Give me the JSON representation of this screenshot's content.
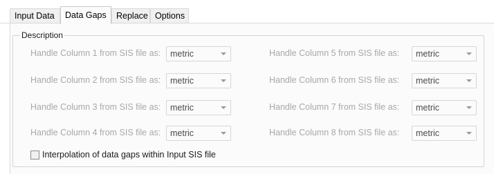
{
  "tabs": [
    {
      "label": "Input Data",
      "active": false
    },
    {
      "label": "Data Gaps",
      "active": true
    },
    {
      "label": "Replace",
      "active": false
    },
    {
      "label": "Options",
      "active": false
    }
  ],
  "group": {
    "title": "Description",
    "rows": [
      {
        "label": "Handle Column 1 from SIS file as:",
        "value": "metric",
        "enabled": false
      },
      {
        "label": "Handle Column 2 from SIS file as:",
        "value": "metric",
        "enabled": false
      },
      {
        "label": "Handle Column 3 from SIS file as:",
        "value": "metric",
        "enabled": false
      },
      {
        "label": "Handle Column 4 from SIS file as:",
        "value": "metric",
        "enabled": false
      },
      {
        "label": "Handle Column 5 from SIS file as:",
        "value": "metric",
        "enabled": false
      },
      {
        "label": "Handle Column 6 from SIS file as:",
        "value": "metric",
        "enabled": false
      },
      {
        "label": "Handle Column 7 from SIS file as:",
        "value": "metric",
        "enabled": false
      },
      {
        "label": "Handle Column 8 from SIS file as:",
        "value": "metric",
        "enabled": false
      }
    ],
    "interpolation": {
      "label": "Interpolation of data gaps within Input SIS file",
      "checked": false
    }
  },
  "colors": {
    "disabled_text": "#a8a8a8",
    "border": "#d4d4d4"
  }
}
